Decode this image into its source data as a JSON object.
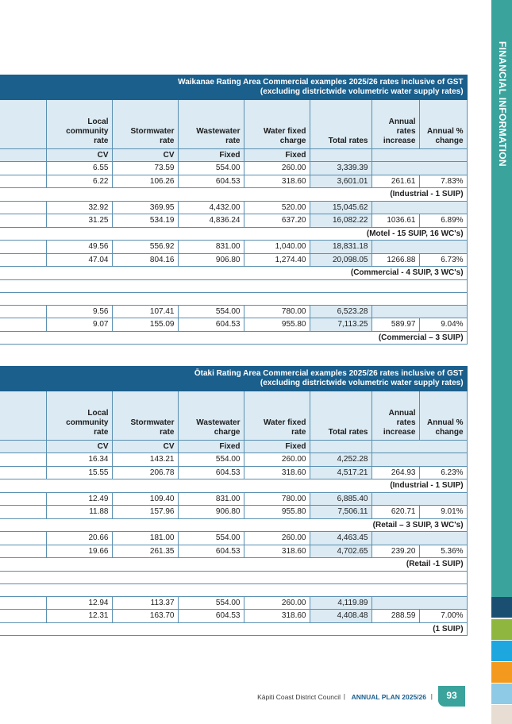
{
  "side": {
    "title": "FINANCIAL INFORMATION",
    "colors": [
      "#3aa39c",
      "#1b4f72",
      "#8fb63e",
      "#1ea7de",
      "#f39a1e",
      "#8ec9e6",
      "#e7ddd2"
    ]
  },
  "waikanae": {
    "title_line1": "Waikanae Rating Area Commercial examples 2025/26 rates inclusive of GST",
    "title_line2": "(excluding districtwide volumetric water supply rates)",
    "headers": [
      "Local community rate",
      "Stormwater rate",
      "Wastewater rate",
      "Water fixed charge",
      "Total rates",
      "Annual rates increase",
      "Annual % change"
    ],
    "units": [
      "CV",
      "CV",
      "Fixed",
      "Fixed"
    ],
    "groups": [
      {
        "rows": [
          [
            "6.55",
            "73.59",
            "554.00",
            "260.00",
            "3,339.39",
            "",
            ""
          ],
          [
            "6.22",
            "106.26",
            "604.53",
            "318.60",
            "3,601.01",
            "261.61",
            "7.83%"
          ]
        ],
        "label": "(Industrial - 1 SUIP)"
      },
      {
        "rows": [
          [
            "32.92",
            "369.95",
            "4,432.00",
            "520.00",
            "15,045.62",
            "",
            ""
          ],
          [
            "31.25",
            "534.19",
            "4,836.24",
            "637.20",
            "16,082.22",
            "1036.61",
            "6.89%"
          ]
        ],
        "label": "(Motel - 15 SUIP, 16 WC's)"
      },
      {
        "rows": [
          [
            "49.56",
            "556.92",
            "831.00",
            "1,040.00",
            "18,831.18",
            "",
            ""
          ],
          [
            "47.04",
            "804.16",
            "906.80",
            "1,274.40",
            "20,098.05",
            "1266.88",
            "6.73%"
          ]
        ],
        "label": "(Commercial - 4 SUIP, 3 WC's)"
      },
      {
        "rows": [
          [
            "9.56",
            "107.41",
            "554.00",
            "780.00",
            "6,523.28",
            "",
            ""
          ],
          [
            "9.07",
            "155.09",
            "604.53",
            "955.80",
            "7,113.25",
            "589.97",
            "9.04%"
          ]
        ],
        "label": "(Commercial – 3 SUIP)"
      }
    ]
  },
  "otaki": {
    "title_line1": "Ōtaki Rating Area Commercial examples 2025/26 rates inclusive of GST",
    "title_line2": "(excluding districtwide volumetric water supply rates)",
    "headers": [
      "Local community rate",
      "Stormwater rate",
      "Wastewater charge",
      "Water fixed rate",
      "Total rates",
      "Annual rates increase",
      "Annual % change"
    ],
    "units": [
      "CV",
      "CV",
      "Fixed",
      "Fixed"
    ],
    "groups": [
      {
        "rows": [
          [
            "16.34",
            "143.21",
            "554.00",
            "260.00",
            "4,252.28",
            "",
            ""
          ],
          [
            "15.55",
            "206.78",
            "604.53",
            "318.60",
            "4,517.21",
            "264.93",
            "6.23%"
          ]
        ],
        "label": "(Industrial - 1 SUIP)"
      },
      {
        "rows": [
          [
            "12.49",
            "109.40",
            "831.00",
            "780.00",
            "6,885.40",
            "",
            ""
          ],
          [
            "11.88",
            "157.96",
            "906.80",
            "955.80",
            "7,506.11",
            "620.71",
            "9.01%"
          ]
        ],
        "label": "(Retail – 3 SUIP, 3 WC's)"
      },
      {
        "rows": [
          [
            "20.66",
            "181.00",
            "554.00",
            "260.00",
            "4,463.45",
            "",
            ""
          ],
          [
            "19.66",
            "261.35",
            "604.53",
            "318.60",
            "4,702.65",
            "239.20",
            "5.36%"
          ]
        ],
        "label": "(Retail -1 SUIP)"
      },
      {
        "rows": [
          [
            "12.94",
            "113.37",
            "554.00",
            "260.00",
            "4,119.89",
            "",
            ""
          ],
          [
            "12.31",
            "163.70",
            "604.53",
            "318.60",
            "4,408.48",
            "288.59",
            "7.00%"
          ]
        ],
        "label": "(1 SUIP)"
      }
    ]
  },
  "footer": {
    "council": "Kāpiti Coast District Council",
    "separator": "|",
    "plan": "ANNUAL PLAN 2025/26",
    "page_number": "93"
  }
}
